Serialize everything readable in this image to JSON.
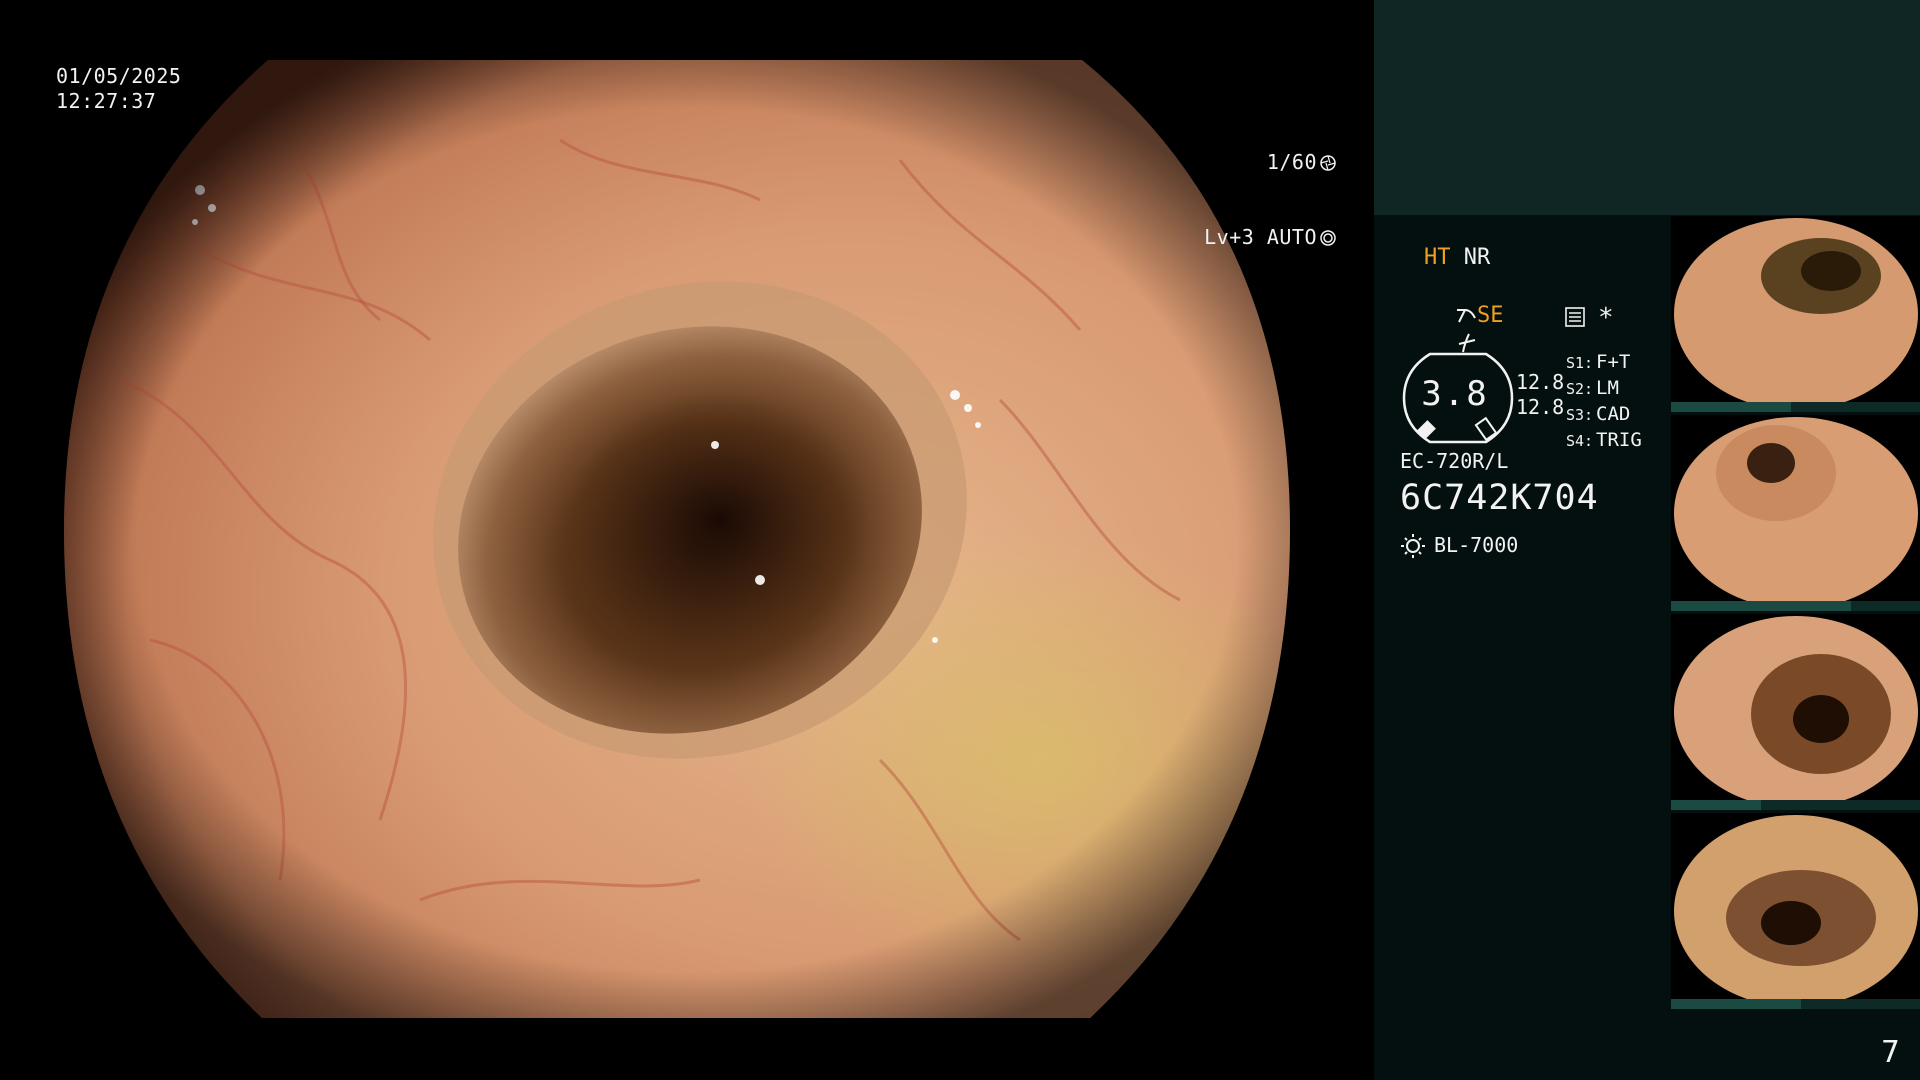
{
  "overlay": {
    "date": "01/05/2025",
    "time": "12:27:37",
    "shutter": "1/60",
    "shutter_icon": "shutter-icon",
    "brightness": "Lv+3 AUTO",
    "auto_icon": "iris-icon"
  },
  "panel": {
    "mode_ht": "HT",
    "mode_nr": "NR",
    "mode_se": "SE",
    "se_icon": "enhance-icon",
    "pulse_icon": "pulse-icon",
    "memory_icon": "memory-icon",
    "star": "*",
    "gauge_value": "3.8",
    "g_val_1": "12.8",
    "g_val_2": "12.8",
    "switches": [
      {
        "key": "S1:",
        "value": "F+T"
      },
      {
        "key": "S2:",
        "value": "LM"
      },
      {
        "key": "S3:",
        "value": "CAD"
      },
      {
        "key": "S4:",
        "value": "TRIG"
      }
    ],
    "scope_model": "EC-720R/L",
    "scope_serial": "6C742K704",
    "light_source": "BL-7000",
    "light_icon": "light-source-icon",
    "page_number": "7"
  },
  "colors": {
    "panel_bg": "#04100f",
    "panel_top": "#0f2624",
    "amber": "#f0a020",
    "text": "#f2f2f2"
  }
}
